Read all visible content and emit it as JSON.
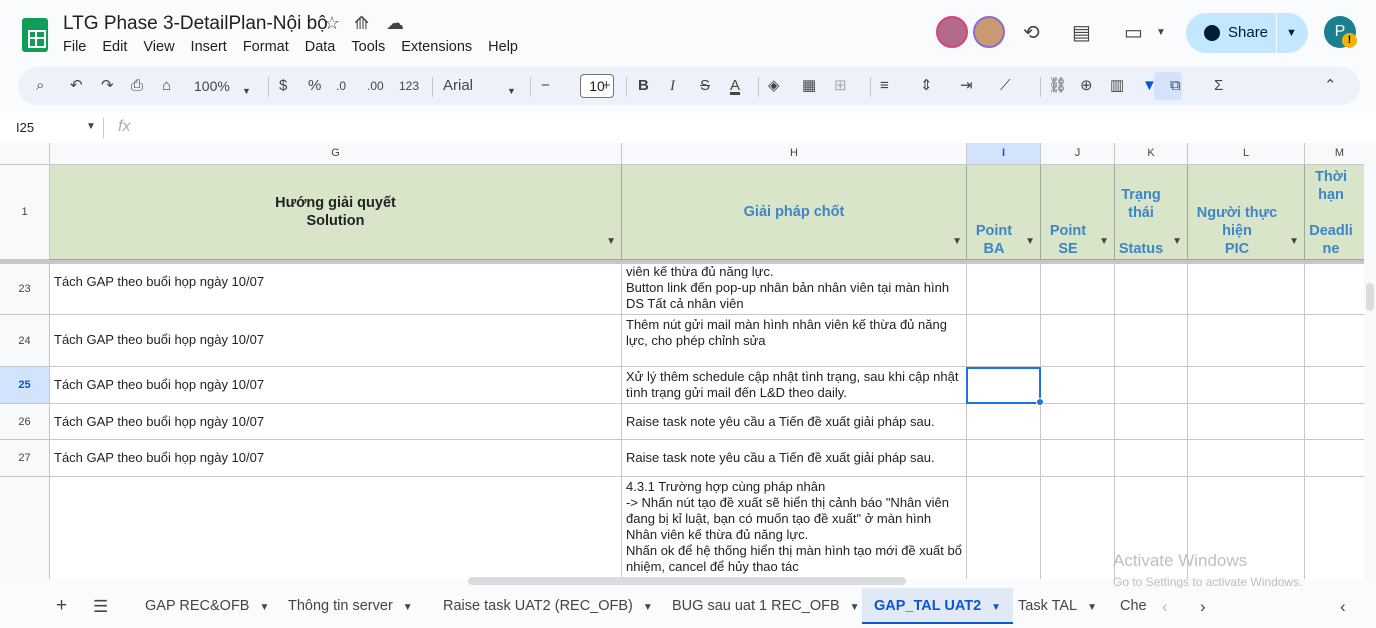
{
  "doc": {
    "title": "LTG Phase 3-DetailPlan-Nội bộ"
  },
  "menu": [
    "File",
    "Edit",
    "View",
    "Insert",
    "Format",
    "Data",
    "Tools",
    "Extensions",
    "Help"
  ],
  "header_right": {
    "share_label": "Share",
    "user_initial": "P",
    "badge": "!"
  },
  "toolbar": {
    "zoom": "100%",
    "currency": "$",
    "percent": "%",
    "dec_dec": ".0",
    "dec_inc": ".00",
    "number_format": "123",
    "font": "Arial",
    "font_size": "10",
    "bold": "B",
    "italic": "I",
    "strike": "S",
    "text_color": "A"
  },
  "formula": {
    "cell_ref": "I25",
    "fx": "fx"
  },
  "columns": {
    "G": "G",
    "H": "H",
    "I": "I",
    "J": "J",
    "K": "K",
    "L": "L",
    "M": "M"
  },
  "header_row": {
    "num": "1",
    "G": [
      "Hướng giải quyết",
      "Solution"
    ],
    "H": "Giải pháp chốt",
    "I": [
      "Point",
      "BA"
    ],
    "J": [
      "Point",
      "SE"
    ],
    "K": [
      "Trạng",
      "thái",
      "",
      "Status"
    ],
    "L": [
      "Người thực",
      "hiện",
      "PIC"
    ],
    "M": [
      "Thời",
      "hạn",
      "",
      "Deadli",
      "ne"
    ]
  },
  "rows": [
    {
      "num": "23",
      "G": "Tách GAP theo buổi họp ngày 10/07",
      "H": [
        "viên kế thừa đủ năng lực.",
        "Button link đến pop-up nhân bản nhân viên tại màn hình",
        "DS Tất cả nhân viên"
      ]
    },
    {
      "num": "24",
      "G": "Tách GAP theo buổi họp ngày 10/07",
      "H": [
        "Thêm nút gửi mail màn hình nhân viên kế thừa đủ năng",
        "lực, cho phép chỉnh sửa"
      ]
    },
    {
      "num": "25",
      "G": "Tách GAP theo buổi họp ngày 10/07",
      "H": [
        "Xử lý thêm schedule cập nhật tình trạng, sau khi cập nhật",
        "tình trạng gửi mail đến L&D theo daily."
      ]
    },
    {
      "num": "26",
      "G": "Tách GAP theo buổi họp ngày 10/07",
      "H": [
        "Raise task note yêu cầu a Tiến đề xuất giải pháp sau."
      ]
    },
    {
      "num": "27",
      "G": "Tách GAP theo buổi họp ngày 10/07",
      "H": [
        "Raise task note yêu cầu a Tiến đề xuất giải pháp sau."
      ]
    },
    {
      "num": "",
      "G": "",
      "H": [
        "4.3.1 Trường hợp cùng pháp nhân",
        "-> Nhấn nút tạo đề xuất sẽ hiển thị cảnh báo \"Nhân viên",
        "đang bị kỉ luật, bạn có muốn tạo đề xuất\" ở màn hình",
        "Nhân viên kế thừa đủ năng lực.",
        "Nhấn ok để hệ thống hiển thị màn hình tạo mới đề xuất bổ",
        "nhiệm, cancel để hủy thao tác"
      ]
    }
  ],
  "watermark": {
    "line1": "Activate Windows",
    "line2": "Go to Settings to activate Windows."
  },
  "sheets": [
    {
      "label": "GAP REC&OFB",
      "active": false
    },
    {
      "label": "Thông tin server",
      "active": false
    },
    {
      "label": "Raise task UAT2 (REC_OFB)",
      "active": false
    },
    {
      "label": "BUG sau uat 1 REC_OFB",
      "active": false
    },
    {
      "label": "GAP_TAL UAT2",
      "active": true
    },
    {
      "label": "Task TAL",
      "active": false
    },
    {
      "label": "Che",
      "active": false
    }
  ],
  "colors": {
    "header_bg": "#d9e5c8",
    "header_blue": "#3d85c6",
    "selection": "#1a73e8",
    "share_bg": "#c2e7ff"
  }
}
